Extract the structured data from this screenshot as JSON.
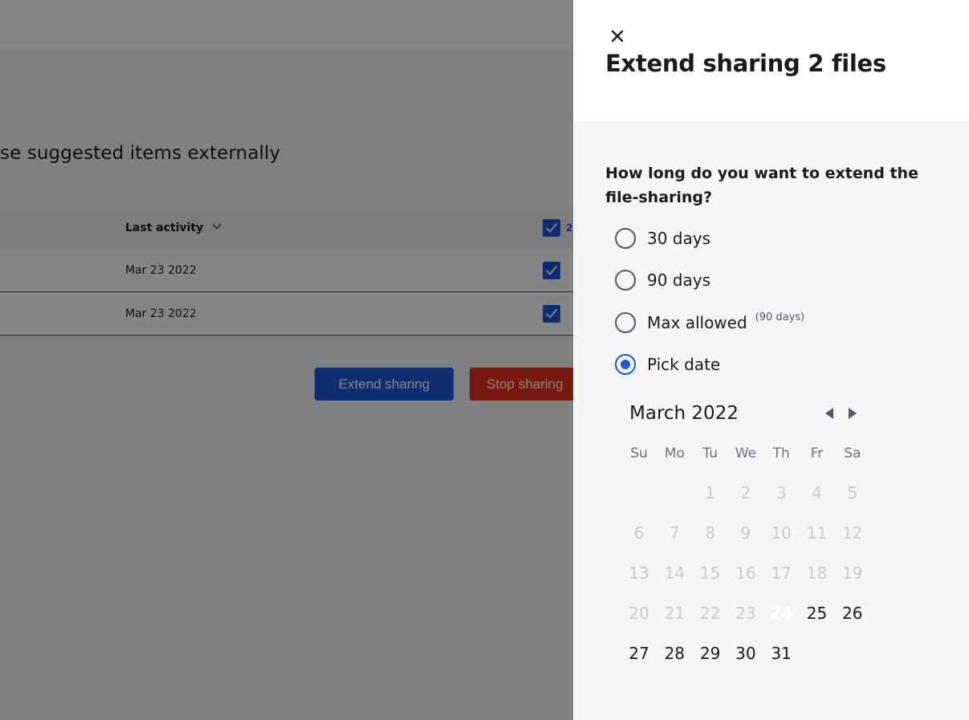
{
  "background": {
    "heading": "se suggested items externally",
    "table": {
      "header_label": "Last activity",
      "selected_count": "2",
      "rows": [
        {
          "date": "Mar 23 2022"
        },
        {
          "date": "Mar 23 2022"
        }
      ]
    },
    "buttons": {
      "extend": "Extend sharing",
      "stop": "Stop sharing"
    }
  },
  "panel": {
    "title": "Extend sharing 2 files",
    "question": "How long do you want to extend the file-sharing?",
    "options": [
      {
        "label": "30 days",
        "note": "",
        "selected": false
      },
      {
        "label": "90 days",
        "note": "",
        "selected": false
      },
      {
        "label": "Max allowed",
        "note": "(90 days)",
        "selected": false
      },
      {
        "label": "Pick date",
        "note": "",
        "selected": true
      }
    ],
    "calendar": {
      "month_label": "March 2022",
      "weekdays": [
        "Su",
        "Mo",
        "Tu",
        "We",
        "Th",
        "Fr",
        "Sa"
      ],
      "first_weekday_index": 2,
      "days_in_month": 31,
      "selected_day": 24,
      "first_available_day": 24
    }
  },
  "colors": {
    "primary": "#1f56d6",
    "danger": "#e2301b",
    "selected_day": "#3f83f8"
  }
}
